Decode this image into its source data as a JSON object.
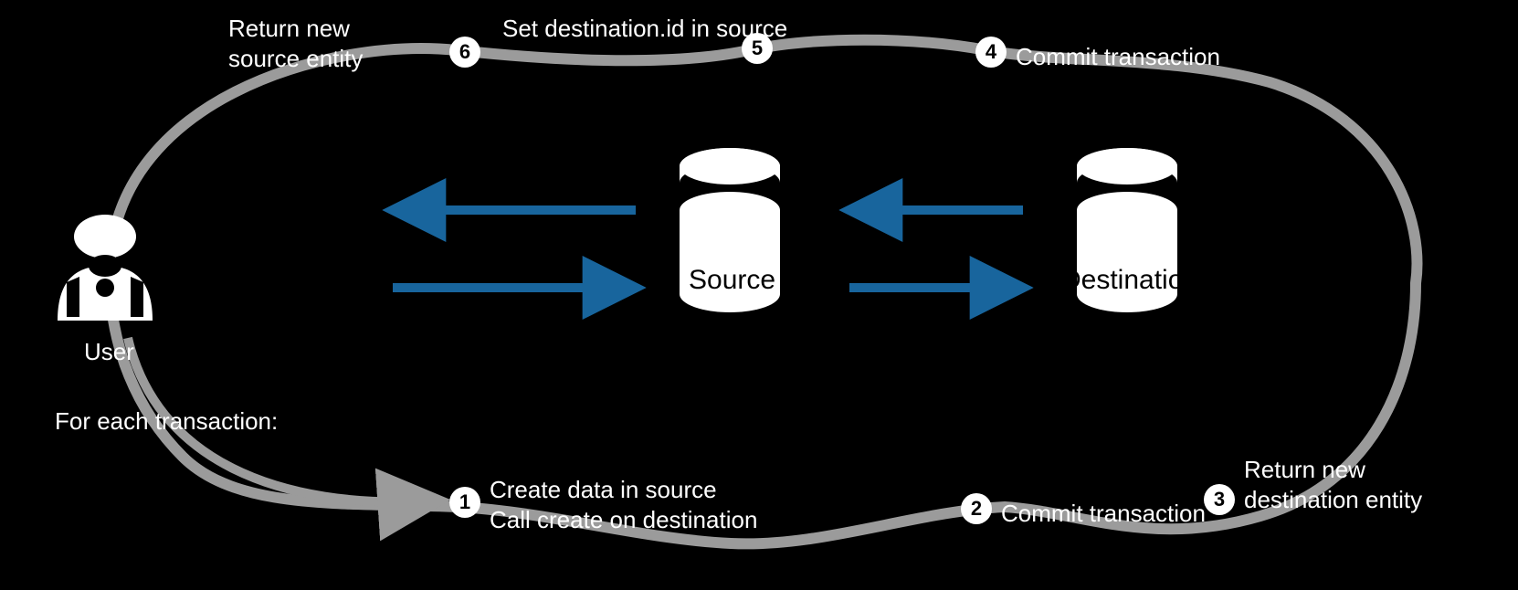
{
  "nodes": {
    "user": "User",
    "source": "Source",
    "destination": "Destination"
  },
  "subtitle": "For each transaction:",
  "steps": [
    {
      "n": "1",
      "t": "Create data in source\nCall create on destination"
    },
    {
      "n": "2",
      "t": "Commit transaction"
    },
    {
      "n": "3",
      "t": "Return new\ndestination entity"
    },
    {
      "n": "4",
      "t": "Commit transaction"
    },
    {
      "n": "5",
      "t": "Set destination.id in source"
    },
    {
      "n": "6",
      "t": "Return new\nsource entity"
    }
  ]
}
